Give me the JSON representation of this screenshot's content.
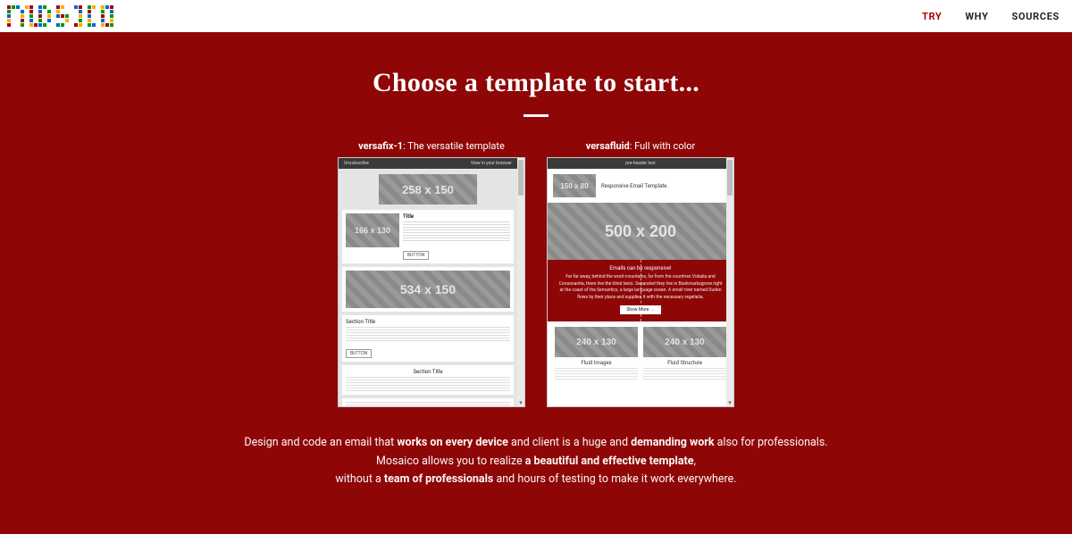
{
  "brand": "MOSAICO",
  "nav": {
    "try": "TRY",
    "why": "WHY",
    "sources": "SOURCES"
  },
  "hero": {
    "title": "Choose a template to start..."
  },
  "templates": {
    "a": {
      "name": "versafix-1",
      "tagline": ": The versatile template",
      "top_left": "Unsubscribe",
      "top_right": "View in your browser",
      "ph1": "258 x 150",
      "ph_sm": "166 x 130",
      "row_title": "Title",
      "button": "BUTTON",
      "ph2": "534 x 150",
      "section1": "Section Title",
      "section2": "Section Title"
    },
    "b": {
      "name": "versafluid",
      "tagline": ": Full with color",
      "top": "pre-header text",
      "logo_ph": "150 x 80",
      "head_txt": "Responsive Email Template.",
      "hero_ph": "500 x 200",
      "body_title": "Emails can be responsive!",
      "body_para": "Far far away, behind the word mountains, far from the countries Vokalia and Consonantia, there live the blind texts. Separated they live in Bookmarksgrove right at the coast of the Semantics, a large language ocean. A small river named Duden flows by their place and supplies it with the necessary regelialia.",
      "body_btn": "Show More →",
      "col_ph": "240 x 130",
      "col1_label": "Fluid Images",
      "col2_label": "Fluid Structure"
    }
  },
  "desc": {
    "l1a": "Design and code an email that ",
    "l1b": "works on every device",
    "l1c": " and client is a huge and ",
    "l1d": "demanding work",
    "l1e": " also for professionals.",
    "l2a": "Mosaico allows you to realize ",
    "l2b": "a beautiful and effective template",
    "l2c": ",",
    "l3a": "without a ",
    "l3b": "team of professionals",
    "l3c": " and hours of testing to make it work everywhere."
  },
  "logo_pixels": [
    "#a00",
    "#090",
    "#06c",
    "",
    "#fa0",
    "#a00",
    "",
    "#06c",
    "#090",
    "",
    "",
    "#a00",
    "#fa0",
    "",
    "",
    "#06c",
    "#a00",
    "",
    "#090",
    "#fa0",
    "",
    "#fa0",
    "#06c",
    "#a00",
    "#090",
    "",
    "",
    "#06c",
    "",
    "#a00",
    "",
    "#06c",
    "",
    "#090",
    "",
    "#fa0",
    "",
    "",
    "",
    "",
    "#06c",
    "",
    "#a00",
    "",
    "",
    "#090",
    "",
    "#06c",
    "#06c",
    "",
    "",
    "#fa0",
    "",
    "#090",
    "",
    "#a00",
    "",
    "#fa0",
    "",
    "#06c",
    "#a00",
    "#090",
    "",
    "",
    "#fa0",
    "",
    "#06c",
    "",
    "",
    "#a00",
    "",
    "#090",
    "#fa0",
    "",
    "",
    "#a00",
    "",
    "#06c",
    "",
    "#090",
    "",
    "#06c",
    "",
    "",
    "",
    "#fa0",
    "",
    "",
    "#090",
    "",
    "#fa0",
    "",
    "",
    "#06c",
    "",
    "#fa0",
    "#a00",
    "",
    "",
    "#090",
    "",
    "#fa0",
    "#a00",
    "#06c",
    "#090",
    "",
    "",
    "#06c",
    "#090",
    "",
    "",
    "#a00",
    "#fa0",
    "",
    "#090",
    "#06c",
    "",
    "#fa0",
    "#a00",
    "#090"
  ]
}
